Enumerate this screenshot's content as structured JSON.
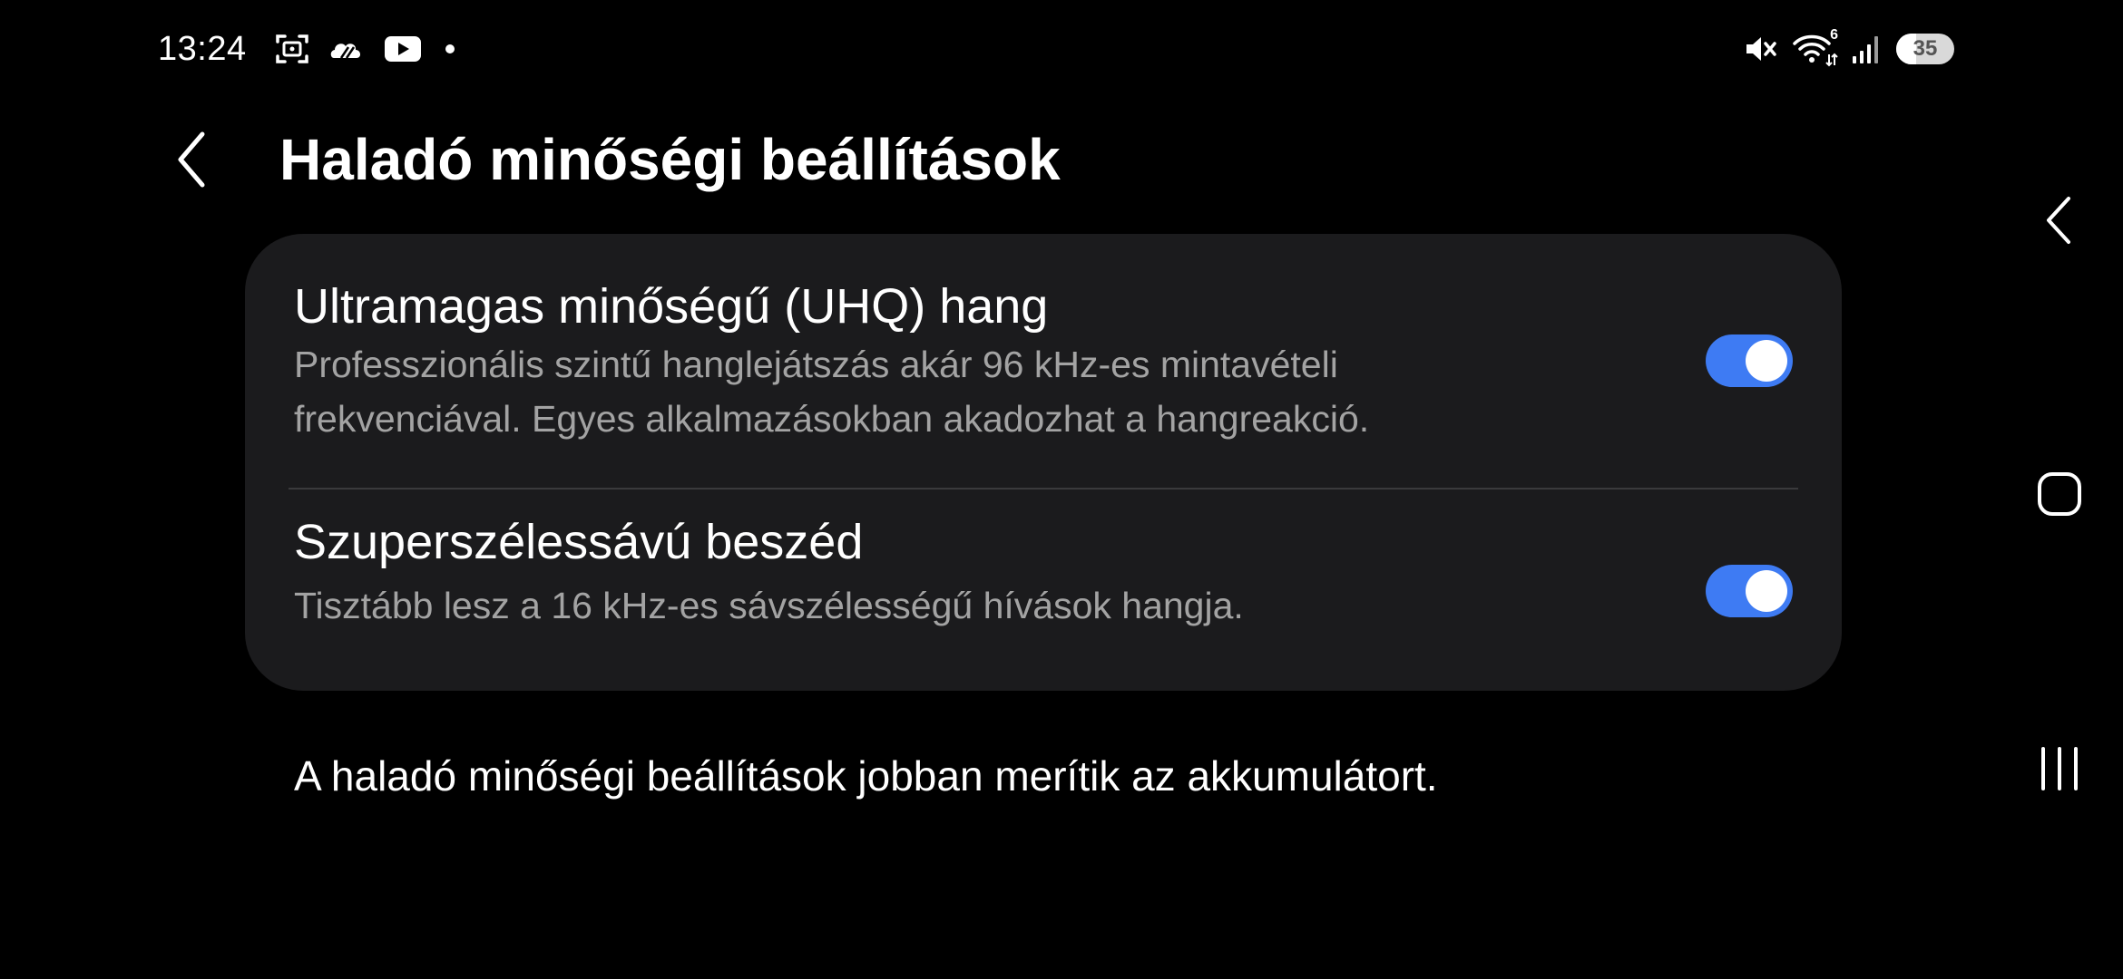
{
  "status_bar": {
    "time": "13:24",
    "left_icons": [
      "screenshot-icon",
      "cloud-weather-icon",
      "youtube-icon",
      "notification-dot-icon"
    ],
    "right_icons": [
      "mute-icon",
      "wifi-icon",
      "signal-icon"
    ],
    "wifi_badge": "6",
    "battery_level": "35",
    "battery_fraction": 0.35
  },
  "header": {
    "back_icon": "chevron-left-icon",
    "title": "Haladó minőségi beállítások"
  },
  "settings": [
    {
      "title": "Ultramagas minőségű (UHQ) hang",
      "description": "Professzionális szintű hanglejátszás akár 96 kHz-es mintavételi frekvenciával. Egyes alkalmazásokban akadozhat a hangreakció.",
      "enabled": true
    },
    {
      "title": "Szuperszélessávú beszéd",
      "description": "Tisztább lesz a 16 kHz-es sávszélességű hívások hangja.",
      "enabled": true
    }
  ],
  "footer_note": "A haladó minőségi beállítások jobban merítik az akkumulátort.",
  "nav_bar": {
    "back": "back-icon",
    "home": "home-icon",
    "recents": "recents-icon"
  },
  "colors": {
    "background": "#000000",
    "card": "#1b1b1d",
    "toggle_on": "#3e7bf3",
    "secondary_text": "#a3a3a3",
    "divider": "#3a3a3c"
  }
}
